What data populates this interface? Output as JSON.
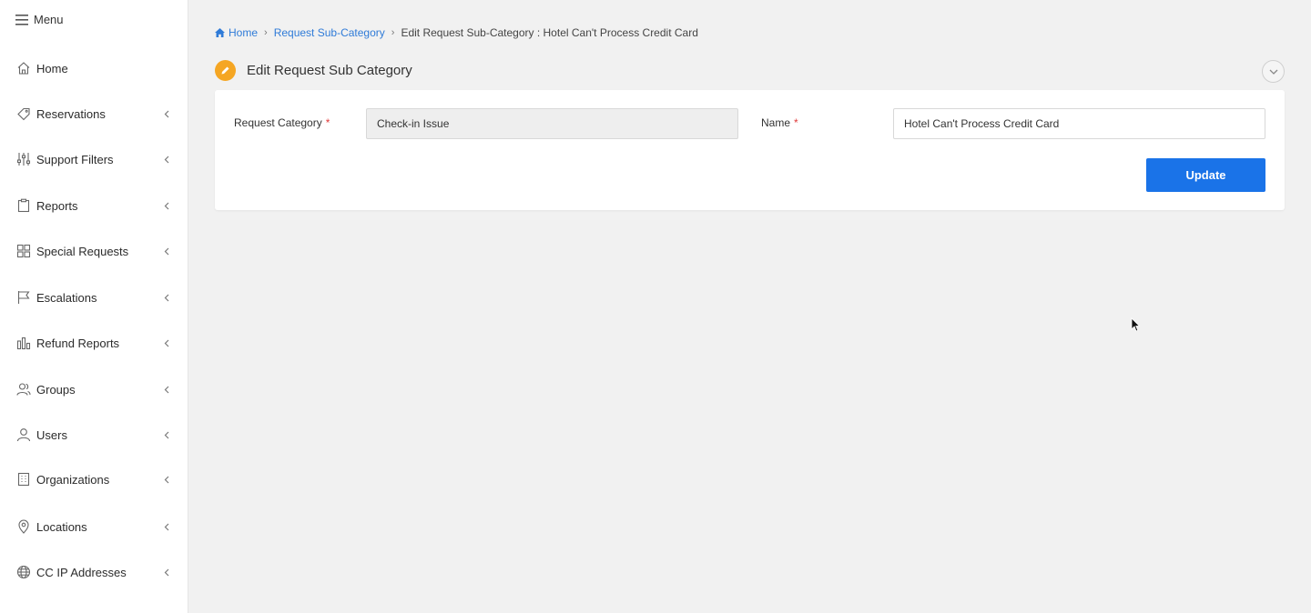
{
  "sidebar": {
    "menu_label": "Menu",
    "items": [
      {
        "label": "Home",
        "icon": "home-icon",
        "has_children": false
      },
      {
        "label": "Reservations",
        "icon": "tag-icon",
        "has_children": true
      },
      {
        "label": "Support Filters",
        "icon": "sliders-icon",
        "has_children": true
      },
      {
        "label": "Reports",
        "icon": "clipboard-icon",
        "has_children": true
      },
      {
        "label": "Special Requests",
        "icon": "grid-icon",
        "has_children": true
      },
      {
        "label": "Escalations",
        "icon": "flag-icon",
        "has_children": true
      },
      {
        "label": "Refund Reports",
        "icon": "bar-chart-icon",
        "has_children": true
      },
      {
        "label": "Groups",
        "icon": "group-icon",
        "has_children": true
      },
      {
        "label": "Users",
        "icon": "user-icon",
        "has_children": true
      },
      {
        "label": "Organizations",
        "icon": "building-icon",
        "has_children": true
      },
      {
        "label": "Locations",
        "icon": "map-pin-icon",
        "has_children": true
      },
      {
        "label": "CC IP Addresses",
        "icon": "globe-icon",
        "has_children": true
      }
    ]
  },
  "breadcrumb": {
    "home": "Home",
    "parent": "Request Sub-Category",
    "current": "Edit Request Sub-Category : Hotel Can't Process Credit Card"
  },
  "page": {
    "title": "Edit Request Sub Category"
  },
  "form": {
    "category_label": "Request Category",
    "category_value": "Check-in Issue",
    "name_label": "Name",
    "name_value": "Hotel Can't Process Credit Card",
    "required_marker": "*",
    "update_label": "Update"
  },
  "colors": {
    "accent": "#1a73e8",
    "link": "#2f7bd8",
    "title_badge": "#f5a623",
    "required": "#e03b3b"
  }
}
